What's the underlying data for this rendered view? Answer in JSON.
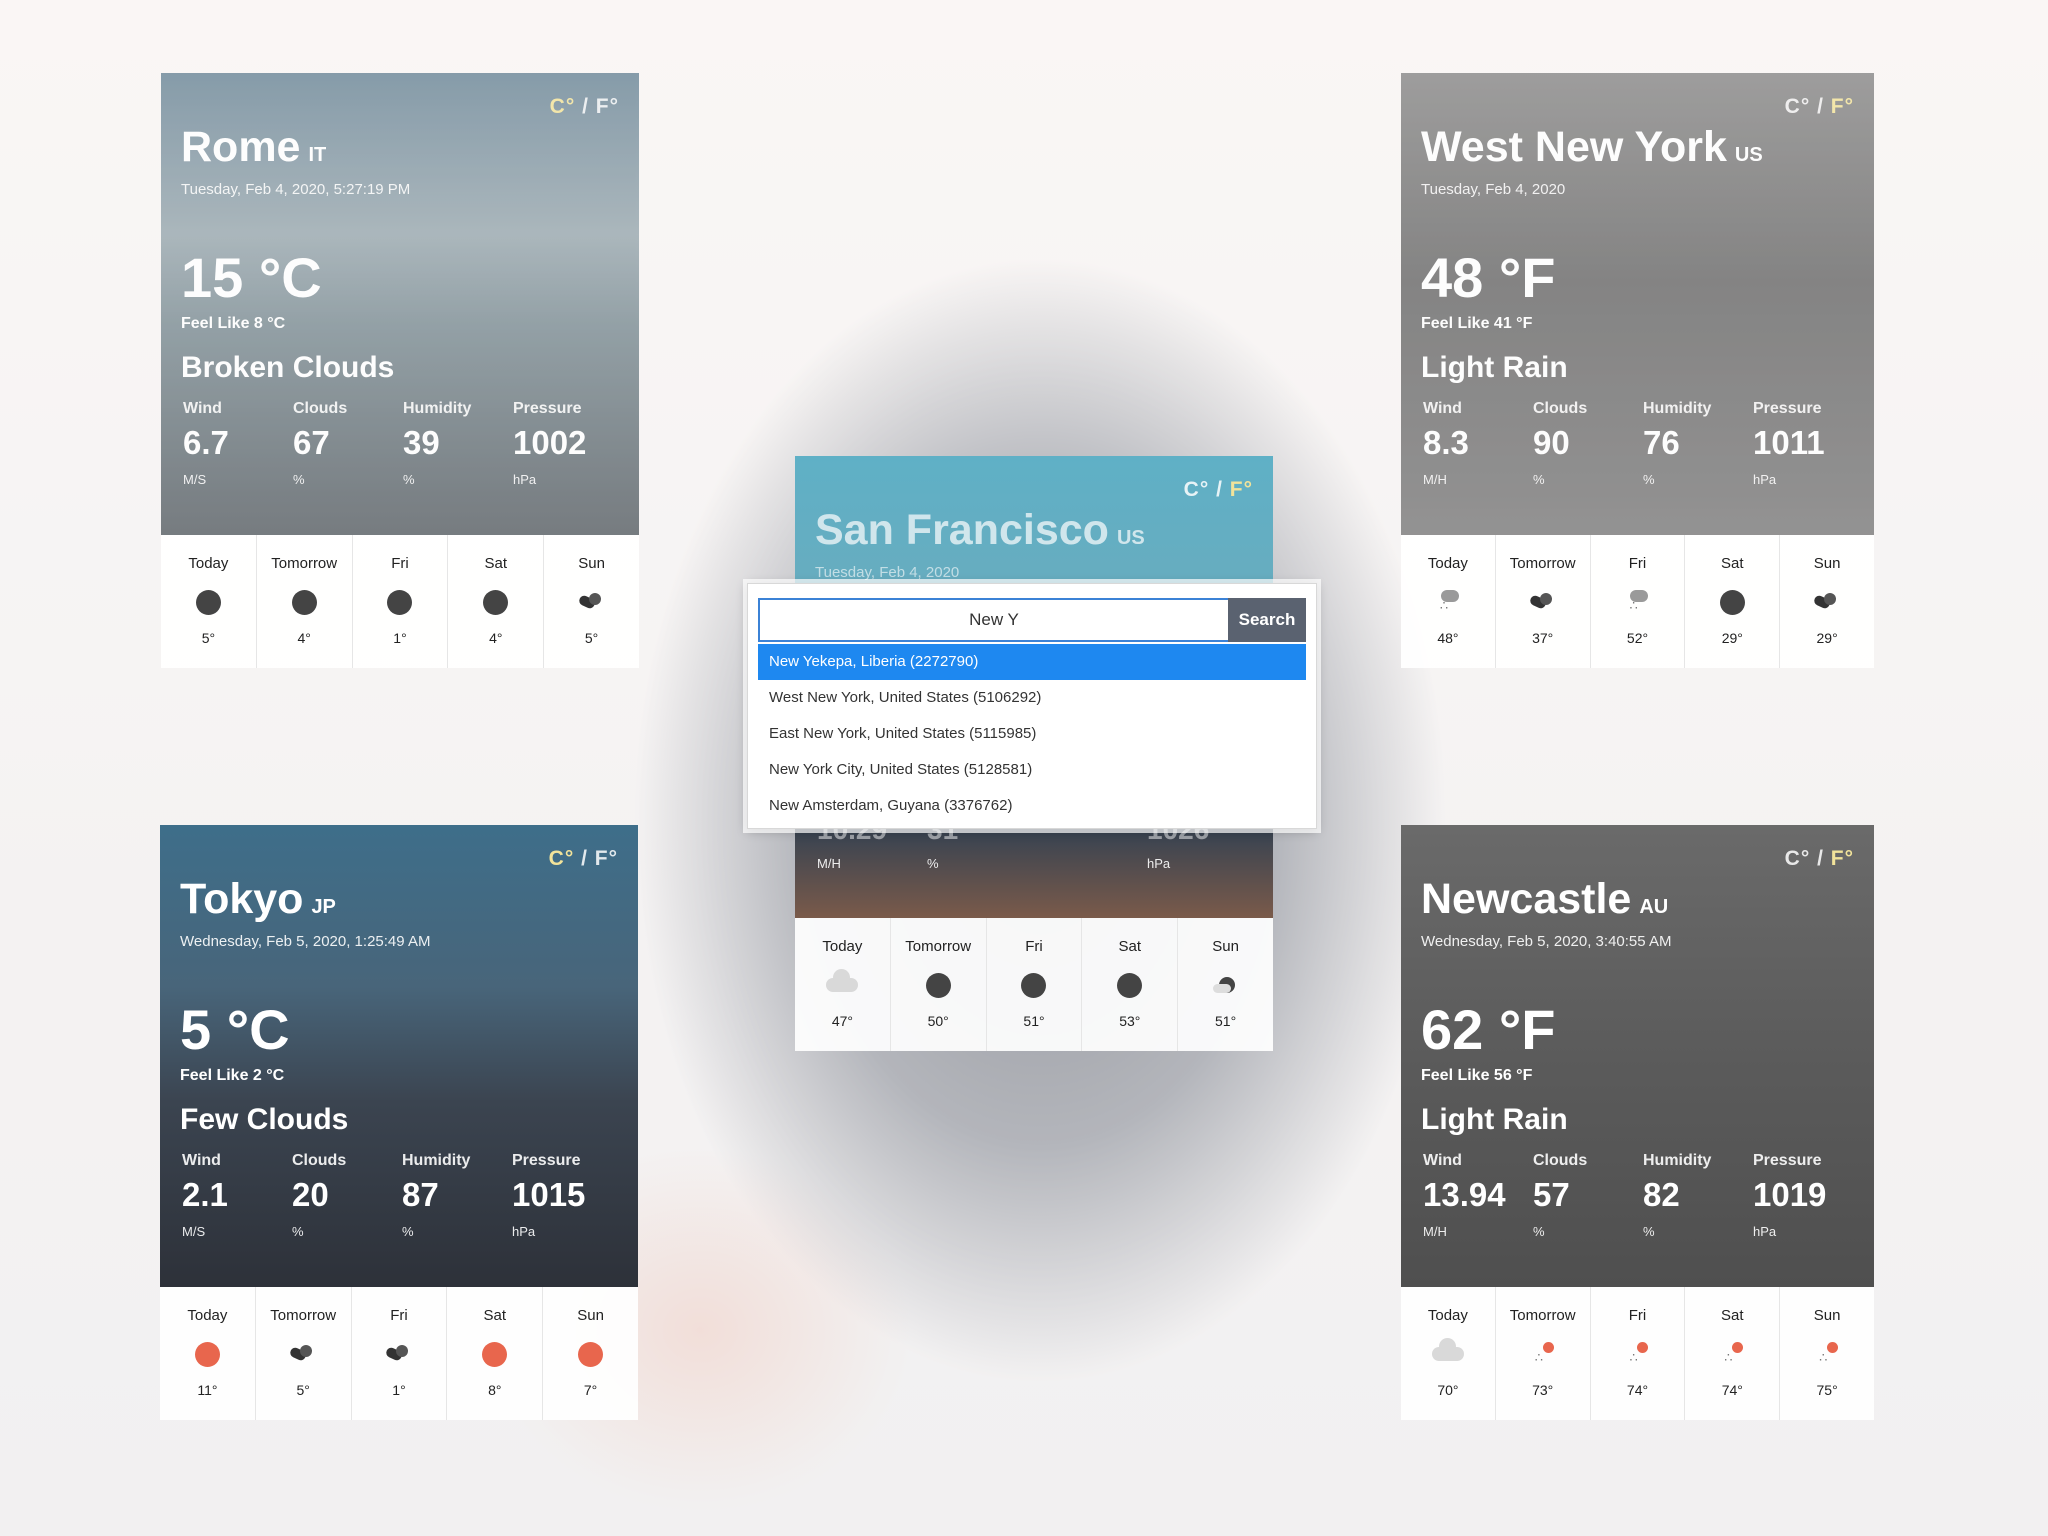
{
  "unit_toggle": {
    "c": "C°",
    "sep": " / ",
    "f": "F°"
  },
  "cards": {
    "rome": {
      "city": "Rome",
      "country": "IT",
      "date": "Tuesday,  Feb 4, 2020, 5:27:19 PM",
      "temp": "15 °C",
      "feel": "Feel Like  8 °C",
      "desc": "Broken Clouds",
      "stats": [
        {
          "label": "Wind",
          "value": "6.7",
          "unit": "M/S"
        },
        {
          "label": "Clouds",
          "value": "67",
          "unit": "%"
        },
        {
          "label": "Humidity",
          "value": "39",
          "unit": "%"
        },
        {
          "label": "Pressure",
          "value": "1002",
          "unit": "hPa"
        }
      ],
      "forecast": [
        {
          "day": "Today",
          "icon": "dot-icon",
          "temp": "5°"
        },
        {
          "day": "Tomorrow",
          "icon": "dot-icon",
          "temp": "4°"
        },
        {
          "day": "Fri",
          "icon": "dot-icon",
          "temp": "1°"
        },
        {
          "day": "Sat",
          "icon": "dot-icon",
          "temp": "4°"
        },
        {
          "day": "Sun",
          "icon": "broken-cloud-icon",
          "temp": "5°"
        }
      ]
    },
    "westny": {
      "city": "West New York",
      "country": "US",
      "date": "Tuesday,  Feb 4, 2020",
      "temp": "48 °F",
      "feel": "Feel Like  41 °F",
      "desc": "Light Rain",
      "stats": [
        {
          "label": "Wind",
          "value": "8.3",
          "unit": "M/H"
        },
        {
          "label": "Clouds",
          "value": "90",
          "unit": "%"
        },
        {
          "label": "Humidity",
          "value": "76",
          "unit": "%"
        },
        {
          "label": "Pressure",
          "value": "1011",
          "unit": "hPa"
        }
      ],
      "forecast": [
        {
          "day": "Today",
          "icon": "rain-icon",
          "temp": "48°"
        },
        {
          "day": "Tomorrow",
          "icon": "broken-cloud-icon",
          "temp": "37°"
        },
        {
          "day": "Fri",
          "icon": "rain-icon",
          "temp": "52°"
        },
        {
          "day": "Sat",
          "icon": "dot-icon",
          "temp": "29°"
        },
        {
          "day": "Sun",
          "icon": "broken-cloud-icon",
          "temp": "29°"
        }
      ]
    },
    "sf": {
      "city": "San Francisco",
      "country": "US",
      "date": "Tuesday,  Feb 4, 2020",
      "stats": [
        {
          "label": "",
          "value": "10.29",
          "unit": "M/H"
        },
        {
          "label": "",
          "value": "31",
          "unit": "%"
        },
        {
          "label": "",
          "value": "",
          "unit": ""
        },
        {
          "label": "",
          "value": "1026",
          "unit": "hPa"
        }
      ],
      "forecast": [
        {
          "day": "Today",
          "icon": "cloud-icon",
          "temp": "47°"
        },
        {
          "day": "Tomorrow",
          "icon": "dot-icon",
          "temp": "50°"
        },
        {
          "day": "Fri",
          "icon": "dot-icon",
          "temp": "51°"
        },
        {
          "day": "Sat",
          "icon": "dot-icon",
          "temp": "53°"
        },
        {
          "day": "Sun",
          "icon": "partly-cloudy-icon",
          "temp": "51°"
        }
      ]
    },
    "tokyo": {
      "city": "Tokyo",
      "country": "JP",
      "date": "Wednesday,  Feb 5, 2020, 1:25:49 AM",
      "temp": "5 °C",
      "feel": "Feel Like  2 °C",
      "desc": "Few Clouds",
      "stats": [
        {
          "label": "Wind",
          "value": "2.1",
          "unit": "M/S"
        },
        {
          "label": "Clouds",
          "value": "20",
          "unit": "%"
        },
        {
          "label": "Humidity",
          "value": "87",
          "unit": "%"
        },
        {
          "label": "Pressure",
          "value": "1015",
          "unit": "hPa"
        }
      ],
      "forecast": [
        {
          "day": "Today",
          "icon": "sun-icon",
          "temp": "11°"
        },
        {
          "day": "Tomorrow",
          "icon": "broken-cloud-icon",
          "temp": "5°"
        },
        {
          "day": "Fri",
          "icon": "broken-cloud-icon",
          "temp": "1°"
        },
        {
          "day": "Sat",
          "icon": "sun-icon",
          "temp": "8°"
        },
        {
          "day": "Sun",
          "icon": "sun-icon",
          "temp": "7°"
        }
      ]
    },
    "newcastle": {
      "city": "Newcastle",
      "country": "AU",
      "date": "Wednesday,  Feb 5, 2020, 3:40:55 AM",
      "temp": "62 °F",
      "feel": "Feel Like  56 °F",
      "desc": "Light Rain",
      "stats": [
        {
          "label": "Wind",
          "value": "13.94",
          "unit": "M/H"
        },
        {
          "label": "Clouds",
          "value": "57",
          "unit": "%"
        },
        {
          "label": "Humidity",
          "value": "82",
          "unit": "%"
        },
        {
          "label": "Pressure",
          "value": "1019",
          "unit": "hPa"
        }
      ],
      "forecast": [
        {
          "day": "Today",
          "icon": "cloud-icon",
          "temp": "70°"
        },
        {
          "day": "Tomorrow",
          "icon": "sun-rain-icon",
          "temp": "73°"
        },
        {
          "day": "Fri",
          "icon": "sun-rain-icon",
          "temp": "74°"
        },
        {
          "day": "Sat",
          "icon": "sun-rain-icon",
          "temp": "74°"
        },
        {
          "day": "Sun",
          "icon": "sun-rain-icon",
          "temp": "75°"
        }
      ]
    }
  },
  "search": {
    "value": "New Y",
    "button": "Search",
    "suggestions": [
      "New Yekepa, Liberia (2272790)",
      "West New York, United States (5106292)",
      "East New York, United States (5115985)",
      "New York City, United States (5128581)",
      "New Amsterdam, Guyana (3376762)"
    ]
  }
}
